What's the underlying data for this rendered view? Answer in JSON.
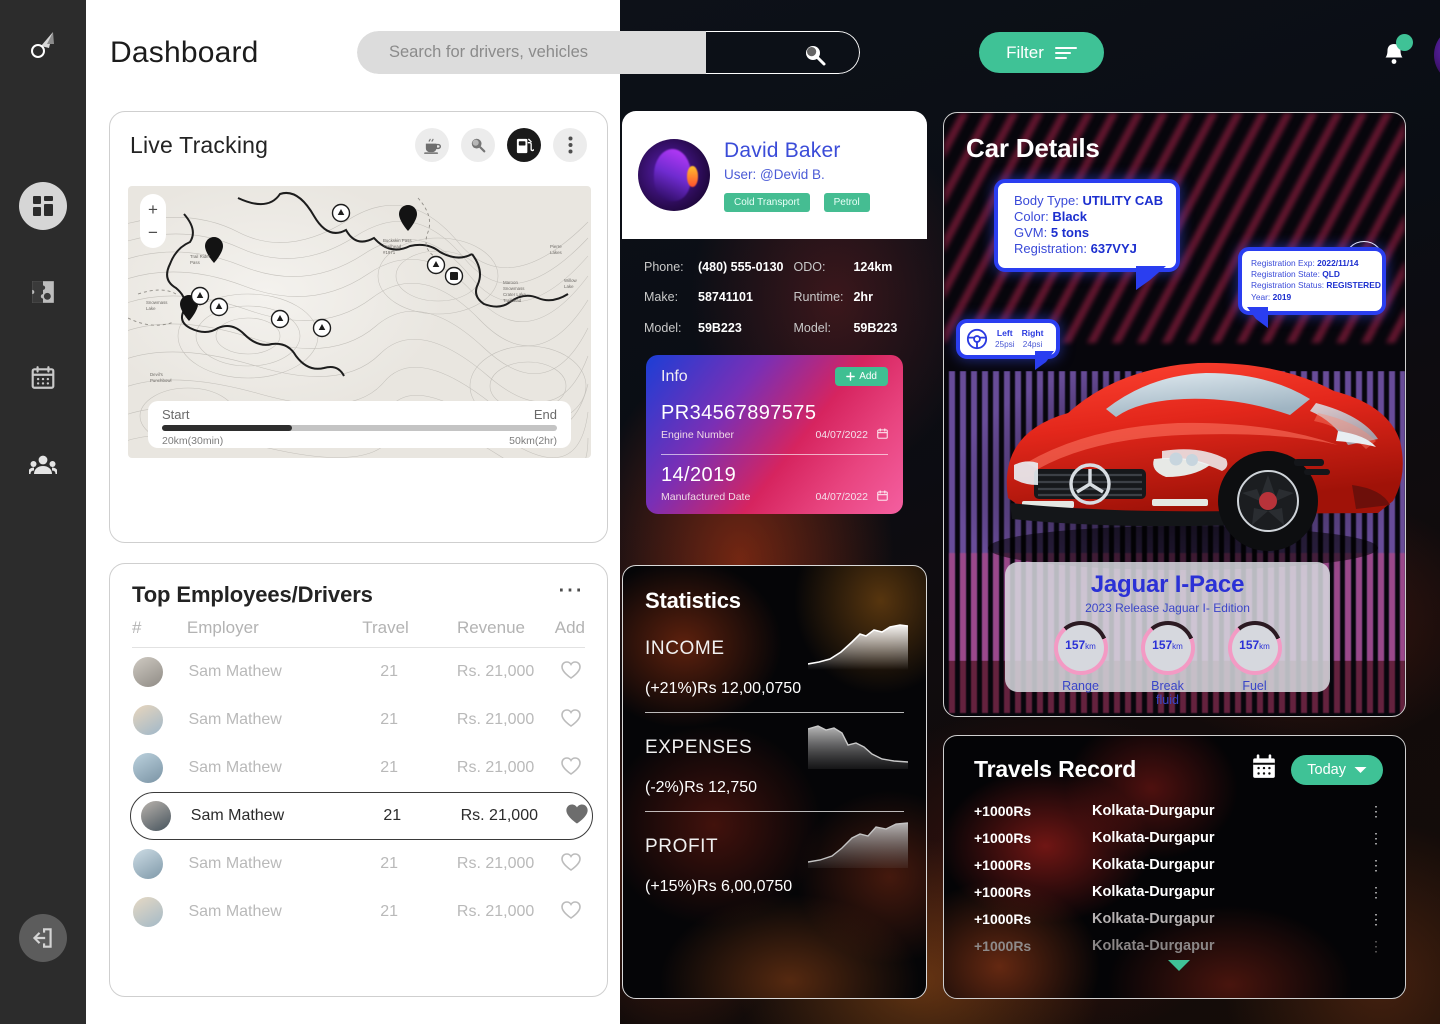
{
  "app": {
    "logo_icon": "rocket-icon",
    "title": "Dashboard"
  },
  "sidebar": {
    "items": [
      {
        "icon": "dashboard-grid-icon",
        "name": "dashboard",
        "active": true
      },
      {
        "icon": "puzzle-icon",
        "name": "integrations",
        "active": false
      },
      {
        "icon": "calendar-icon",
        "name": "schedule",
        "active": false
      },
      {
        "icon": "people-icon",
        "name": "team",
        "active": false
      }
    ],
    "logout_icon": "logout-icon"
  },
  "header": {
    "search": {
      "placeholder": "Search for drivers, vehicles",
      "value": "",
      "icon": "search-icon"
    },
    "filter": {
      "label": "Filter",
      "icon": "filter-lines-icon"
    },
    "notification": {
      "icon": "bell-icon",
      "has_badge": true
    },
    "avatar": {
      "name": "user-avatar"
    }
  },
  "live_tracking": {
    "title": "Live Tracking",
    "actions": [
      {
        "name": "coffee-break-button",
        "icon": "coffee-cup-icon",
        "active": false
      },
      {
        "name": "map-search-button",
        "icon": "search-icon",
        "active": false
      },
      {
        "name": "fuel-station-button",
        "icon": "fuel-pump-icon",
        "active": true
      },
      {
        "name": "more-options-button",
        "icon": "vertical-dots-icon",
        "active": false
      }
    ],
    "zoom_in": "+",
    "zoom_out": "−",
    "slider": {
      "start_label": "Start",
      "end_label": "End",
      "start_value": "20km(30min)",
      "end_value": "50km(2hr)",
      "progress": 33
    }
  },
  "employees": {
    "title": "Top Employees/Drivers",
    "more_icon": "horizontal-dots-icon",
    "columns": [
      "#",
      "Employer",
      "Travel",
      "Revenue",
      "Add"
    ],
    "rows": [
      {
        "name": "Sam Mathew",
        "travel": "21",
        "revenue": "Rs. 21,000",
        "favorite": false,
        "selected": false
      },
      {
        "name": "Sam Mathew",
        "travel": "21",
        "revenue": "Rs. 21,000",
        "favorite": false,
        "selected": false
      },
      {
        "name": "Sam Mathew",
        "travel": "21",
        "revenue": "Rs. 21,000",
        "favorite": false,
        "selected": false
      },
      {
        "name": "Sam Mathew",
        "travel": "21",
        "revenue": "Rs. 21,000",
        "favorite": true,
        "selected": true
      },
      {
        "name": "Sam Mathew",
        "travel": "21",
        "revenue": "Rs. 21,000",
        "favorite": false,
        "selected": false
      },
      {
        "name": "Sam Mathew",
        "travel": "21",
        "revenue": "Rs. 21,000",
        "favorite": false,
        "selected": false
      }
    ]
  },
  "driver": {
    "name": "David Baker",
    "user": "User: @Devid B.",
    "tags": [
      "Cold Transport",
      "Petrol"
    ],
    "specs_left": [
      {
        "key": "Phone:",
        "value": "(480) 555-0130"
      },
      {
        "key": "Make:",
        "value": "58741101"
      },
      {
        "key": "Model:",
        "value": "59B223"
      }
    ],
    "specs_right": [
      {
        "key": "ODO:",
        "value": "124km"
      },
      {
        "key": "Runtime:",
        "value": "2hr"
      },
      {
        "key": "Model:",
        "value": "59B223"
      }
    ]
  },
  "info": {
    "title": "Info",
    "add_label": "Add",
    "add_icon": "plus-icon",
    "entries": [
      {
        "value": "PR34567897575",
        "label": "Engine Number",
        "date": "04/07/2022",
        "icon": "calendar-icon"
      },
      {
        "value": "14/2019",
        "label": "Manufactured Date",
        "date": "04/07/2022",
        "icon": "calendar-icon"
      }
    ]
  },
  "statistics": {
    "title": "Statistics",
    "blocks": [
      {
        "label": "INCOME",
        "value": "(+21%)Rs 12,00,0750"
      },
      {
        "label": "EXPENSES",
        "value": "(-2%)Rs 12,750"
      },
      {
        "label": "PROFIT",
        "value": "(+15%)Rs 6,00,0750"
      }
    ]
  },
  "chart_data": [
    {
      "type": "area",
      "title": "INCOME",
      "x": [
        0,
        1,
        2,
        3,
        4,
        5,
        6,
        7,
        8,
        9
      ],
      "values": [
        6,
        7,
        9,
        14,
        28,
        46,
        58,
        62,
        74,
        80
      ],
      "annotation": "(+21%)Rs 12,00,0750",
      "trend": "up",
      "percent_change": 21,
      "amount": "Rs 12,00,0750",
      "grid": false,
      "legend": "none"
    },
    {
      "type": "area",
      "title": "EXPENSES",
      "x": [
        0,
        1,
        2,
        3,
        4,
        5,
        6,
        7,
        8,
        9
      ],
      "values": [
        68,
        72,
        66,
        60,
        40,
        34,
        28,
        20,
        15,
        13
      ],
      "annotation": "(-2%)Rs 12,750",
      "trend": "down",
      "percent_change": -2,
      "amount": "Rs 12,750",
      "grid": false,
      "legend": "none"
    },
    {
      "type": "area",
      "title": "PROFIT",
      "x": [
        0,
        1,
        2,
        3,
        4,
        5,
        6,
        7,
        8,
        9
      ],
      "values": [
        8,
        9,
        12,
        20,
        36,
        52,
        60,
        68,
        76,
        82
      ],
      "annotation": "(+15%)Rs 6,00,0750",
      "trend": "up",
      "percent_change": 15,
      "amount": "Rs 6,00,0750",
      "grid": false,
      "legend": "none"
    }
  ],
  "car_details": {
    "title": "Car Details",
    "search_icon": "search-icon",
    "bubble_main": [
      {
        "key": "Body Type:",
        "value": "UTILITY CAB"
      },
      {
        "key": "Color:",
        "value": "Black"
      },
      {
        "key": "GVM:",
        "value": "5 tons"
      },
      {
        "key": "Registration:",
        "value": "637VYJ"
      }
    ],
    "bubble_registration": [
      {
        "key": "Registration Exp:",
        "value": "2022/11/14"
      },
      {
        "key": "Registration State:",
        "value": "QLD"
      },
      {
        "key": "Registration Status:",
        "value": "REGISTERED"
      },
      {
        "key": "Year:",
        "value": "2019"
      }
    ],
    "tire_pressure": {
      "icon": "steering-wheel-icon",
      "left_label": "Left",
      "left_value": "25psi",
      "right_label": "Right",
      "right_value": "24psi"
    },
    "vehicle": {
      "model": "Jaguar I-Pace",
      "subtitle": "2023 Release Jaguar I- Edition",
      "gauges": [
        {
          "value": "157",
          "unit": "km",
          "label": "Range",
          "percent": 70
        },
        {
          "value": "157",
          "unit": "km",
          "label": "Break fluid",
          "percent": 70
        },
        {
          "value": "157",
          "unit": "km",
          "label": "Fuel",
          "percent": 70
        }
      ]
    }
  },
  "travels": {
    "title": "Travels Record",
    "calendar_icon": "calendar-icon",
    "period_label": "Today",
    "period_icon": "chevron-down-icon",
    "rows": [
      {
        "amount": "+1000Rs",
        "route": "Kolkata-Durgapur",
        "fade": 0
      },
      {
        "amount": "+1000Rs",
        "route": "Kolkata-Durgapur",
        "fade": 0
      },
      {
        "amount": "+1000Rs",
        "route": "Kolkata-Durgapur",
        "fade": 0
      },
      {
        "amount": "+1000Rs",
        "route": "Kolkata-Durgapur",
        "fade": 0
      },
      {
        "amount": "+1000Rs",
        "route": "Kolkata-Durgapur",
        "fade": 1
      },
      {
        "amount": "+1000Rs",
        "route": "Kolkata-Durgapur",
        "fade": 2
      }
    ],
    "expand_icon": "caret-down-icon"
  },
  "colors": {
    "accent_green": "#3fc296",
    "brand_blue": "#2b31d6",
    "bubble_border": "#2a3ef0",
    "sidebar_bg": "#2c2c2c"
  }
}
